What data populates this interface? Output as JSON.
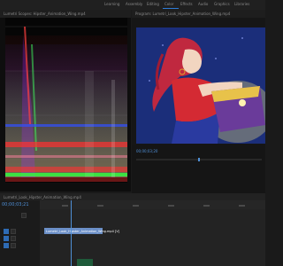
{
  "header": {
    "workspaces": [
      "Learning",
      "Assembly",
      "Editing",
      "Color",
      "Effects",
      "Audio",
      "Graphics",
      "Libraries"
    ],
    "active_workspace": "Color"
  },
  "left_panel": {
    "tabs": [
      "Lumetri Scopes: Hipster_Animation_Wing.mp4"
    ]
  },
  "right_panel": {
    "tabs": [
      "Program: Lumetri_Look_Hipster_Animation_Wing.mp4"
    ],
    "timecode": "00;00;03;20"
  },
  "timeline": {
    "tabs": [
      "Lumetri_Look_Hipster_Animation_Wing.mp4"
    ],
    "timecode": "00;00;03;21",
    "clip_label": "Lumetri_Look_Hipster_Animation_Wing.mp4 [V]"
  },
  "icons": {
    "play": "play-icon",
    "step_back": "step-back-icon",
    "step_forward": "step-forward-icon",
    "add": "add-icon",
    "settings": "wrench-icon"
  },
  "colors": {
    "accent": "#2e7bd6",
    "clip": "#6b8fc7",
    "audio_clip": "#1e5a3a"
  }
}
